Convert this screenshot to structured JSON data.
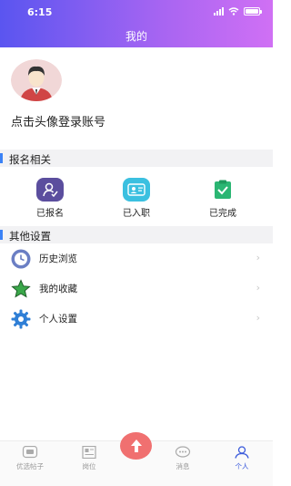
{
  "status_bar": {
    "time": "6:15"
  },
  "header": {
    "title": "我的"
  },
  "profile": {
    "login_prompt": "点击头像登录账号"
  },
  "sections": {
    "registration": {
      "title": "报名相关",
      "items": [
        {
          "label": "已报名",
          "icon": "signup-user-icon",
          "color": "#5b4e9e"
        },
        {
          "label": "已入职",
          "icon": "id-card-icon",
          "color": "#3bc0e0"
        },
        {
          "label": "已完成",
          "icon": "clipboard-check-icon",
          "color": "#2bb673"
        }
      ]
    },
    "other": {
      "title": "其他设置",
      "items": [
        {
          "label": "历史浏览",
          "icon": "clock-icon"
        },
        {
          "label": "我的收藏",
          "icon": "star-icon"
        },
        {
          "label": "个人设置",
          "icon": "gear-icon"
        }
      ]
    }
  },
  "tabbar": {
    "items": [
      {
        "label": "优选帖子",
        "icon": "posts-icon"
      },
      {
        "label": "岗位",
        "icon": "jobs-icon"
      },
      {
        "label": "消息",
        "icon": "message-icon"
      },
      {
        "label": "个人",
        "icon": "person-icon",
        "active": true
      }
    ],
    "center": {
      "icon": "upload-arrow-icon",
      "color": "#f07070"
    }
  },
  "accent": "#3b82f6"
}
